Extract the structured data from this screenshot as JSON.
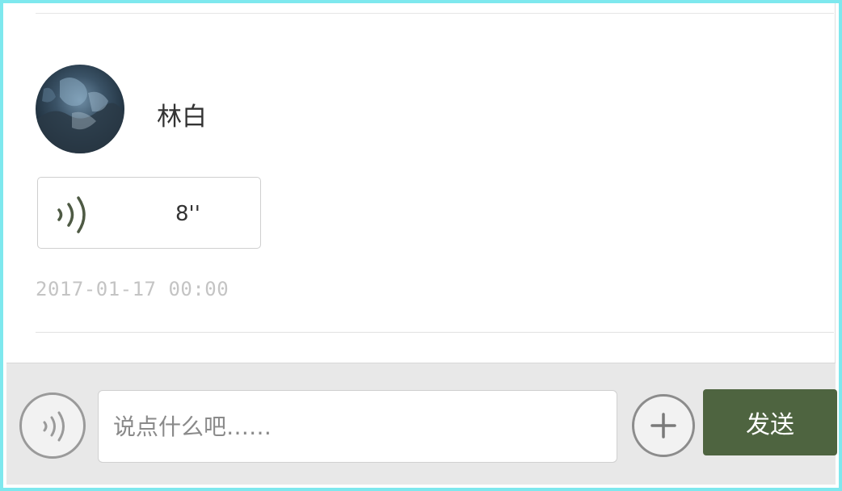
{
  "message": {
    "username": "林白",
    "avatar_icon": "user-avatar-photo",
    "voice": {
      "icon": "voice-wave-icon",
      "duration": "8''"
    },
    "timestamp": "2017-01-17 00:00"
  },
  "composer": {
    "voice_toggle_icon": "voice-wave-icon",
    "input_value": "",
    "input_placeholder": "说点什么吧……",
    "plus_icon": "plus-icon",
    "send_label": "发送"
  },
  "colors": {
    "frame_border": "#7ee8ee",
    "send_button": "#4e6440",
    "wave_icon": "#4e5a44",
    "timestamp": "#c4c4c4"
  }
}
